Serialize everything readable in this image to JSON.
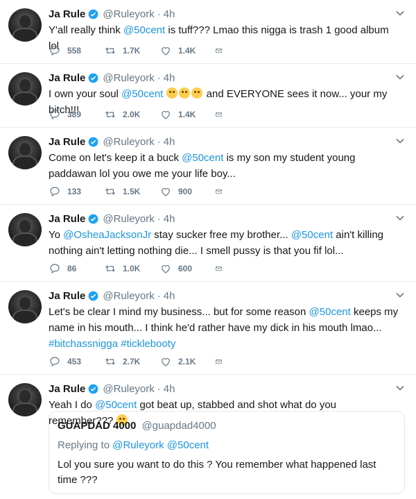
{
  "author": {
    "name": "Ja Rule",
    "handle": "@Ruleyork",
    "time": "4h",
    "separator": "·"
  },
  "icons": {
    "reply": "reply-icon",
    "retweet": "retweet-icon",
    "like": "heart-icon",
    "dm": "envelope-icon",
    "verified": "verified-badge-icon",
    "more": "chevron-down-icon",
    "emoji": "face-emoji-icon"
  },
  "colors": {
    "link": "#1b95e0",
    "muted": "#657786",
    "verified": "#1da1f2"
  },
  "tweets": [
    {
      "parts": [
        "Y'all really think ",
        "@50cent",
        " is tuff??? Lmao this nigga is trash 1 good album lol"
      ],
      "replies": "558",
      "retweets": "1.7K",
      "likes": "1.4K"
    },
    {
      "parts": [
        "I own your soul ",
        "@50cent",
        " ",
        "and EVERYONE sees it now... your my bitch!!!"
      ],
      "replies": "389",
      "retweets": "2.0K",
      "likes": "1.4K"
    },
    {
      "parts": [
        "Come on let's keep it a buck ",
        "@50cent",
        " is my son my student young paddawan lol you owe me your life boy..."
      ],
      "replies": "133",
      "retweets": "1.5K",
      "likes": "900"
    },
    {
      "parts": [
        "Yo ",
        "@OsheaJacksonJr",
        " stay sucker free my brother... ",
        "@50cent",
        " ain't killing nothing ain't letting nothing die... I smell pussy is that you fif lol..."
      ],
      "replies": "86",
      "retweets": "1.0K",
      "likes": "600"
    },
    {
      "parts": [
        "Let's be clear I mind my business... but for some reason ",
        "@50cent",
        " keeps my name in his mouth... I think he'd rather have my dick in his mouth lmao... ",
        "#bitchassnigga",
        " ",
        "#ticklebooty"
      ],
      "replies": "453",
      "retweets": "2.7K",
      "likes": "2.1K"
    },
    {
      "parts": [
        "Yeah I do ",
        "@50cent",
        " got beat up, stabbed and shot what do you remember???"
      ],
      "quote": {
        "name": "GUAPDAD 4000",
        "handle": "@guapdad4000",
        "reply_prefix": "Replying to ",
        "reply_to": "@Ruleyork @50cent",
        "text": "Lol you sure you want to do this ? You remember what happened last time ???"
      }
    }
  ]
}
